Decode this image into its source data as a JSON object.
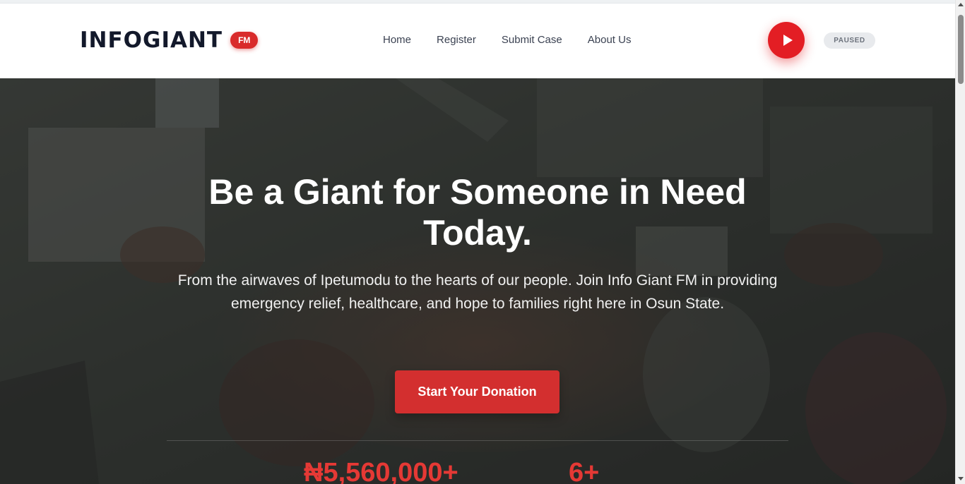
{
  "brand": {
    "name": "INFOGIANT",
    "badge": "FM"
  },
  "nav": [
    {
      "label": "Home"
    },
    {
      "label": "Register"
    },
    {
      "label": "Submit Case"
    },
    {
      "label": "About Us"
    }
  ],
  "player": {
    "play_icon": "play-icon",
    "status": "PAUSED"
  },
  "hero": {
    "title": "Be a Giant for Someone in Need Today.",
    "subtitle": "From the airwaves of Ipetumodu to the hearts of our people. Join Info Giant FM in providing emergency relief, healthcare, and hope to families right here in Osun State.",
    "cta_label": "Start Your Donation"
  },
  "stats": [
    {
      "value": "₦5,560,000+"
    },
    {
      "value": "6+"
    }
  ],
  "colors": {
    "accent": "#e31e24",
    "cta": "#d32f2f",
    "logo_text": "#13192b",
    "nav_text": "#3b4252",
    "status_pill": "#e8eaed"
  }
}
